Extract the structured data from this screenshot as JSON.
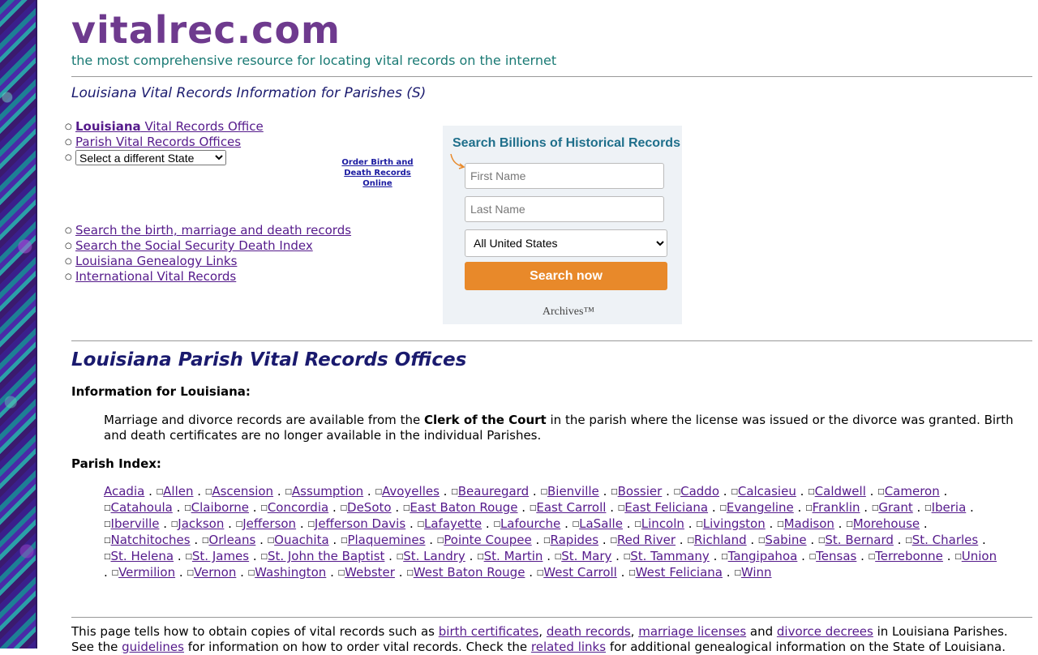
{
  "header": {
    "logo": "vitalrec.com",
    "tagline": "the most comprehensive resource for locating vital records on the internet",
    "subtitle": "Louisiana Vital Records Information for Parishes (S)"
  },
  "top_links": {
    "state_office_bold": "Louisiana",
    "state_office_rest": " Vital Records Office",
    "parish_offices": "Parish Vital Records Offices",
    "state_select_value": "Select a different State"
  },
  "order_link": {
    "line1": "Order Birth and",
    "line2": "Death Records Online"
  },
  "bottom_links": [
    "Search the birth, marriage and death records",
    "Search the Social Security Death Index",
    "Louisiana Genealogy Links",
    "International Vital Records"
  ],
  "search_widget": {
    "title": "Search Billions of Historical Records",
    "first_name_placeholder": "First Name",
    "last_name_placeholder": "Last Name",
    "location_value": "All United States",
    "button_label": "Search now",
    "brand": "Archives™",
    "button_color": "#e8892a",
    "title_color": "#1f6f8b"
  },
  "main": {
    "heading": "Louisiana Parish Vital Records Offices",
    "info_label": "Information for Louisiana:",
    "info_text_before": "Marriage and divorce records are available from the ",
    "info_text_bold": "Clerk of the Court",
    "info_text_after": " in the parish where the license was issued or the divorce was granted. Birth and death certificates are no longer available in the individual Parishes.",
    "index_label": "Parish Index:",
    "parishes": [
      "Acadia",
      "Allen",
      "Ascension",
      "Assumption",
      "Avoyelles",
      "Beauregard",
      "Bienville",
      "Bossier",
      "Caddo",
      "Calcasieu",
      "Caldwell",
      "Cameron",
      "Catahoula",
      "Claiborne",
      "Concordia",
      "DeSoto",
      "East Baton Rouge",
      "East Carroll",
      "East Feliciana",
      "Evangeline",
      "Franklin",
      "Grant",
      "Iberia",
      "Iberville",
      "Jackson",
      "Jefferson",
      "Jefferson Davis",
      "Lafayette",
      "Lafourche",
      "LaSalle",
      "Lincoln",
      "Livingston",
      "Madison",
      "Morehouse",
      "Natchitoches",
      "Orleans",
      "Ouachita",
      "Plaquemines",
      "Pointe Coupee",
      "Rapides",
      "Red River",
      "Richland",
      "Sabine",
      "St. Bernard",
      "St. Charles",
      "St. Helena",
      "St. James",
      "St. John the Baptist",
      "St. Landry",
      "St. Martin",
      "St. Mary",
      "St. Tammany",
      "Tangipahoa",
      "Tensas",
      "Terrebonne",
      "Union",
      "Vermilion",
      "Vernon",
      "Washington",
      "Webster",
      "West Baton Rouge",
      "West Carroll",
      "West Feliciana",
      "Winn"
    ]
  },
  "footer": {
    "t1": "This page tells how to obtain copies of vital records such as ",
    "birth": "birth certificates",
    "t2": ", ",
    "death": "death records",
    "t3": ", ",
    "marriage": "marriage licenses",
    "t4": " and ",
    "divorce": "divorce decrees",
    "t5": " in Louisiana Parishes. See the ",
    "guidelines": "guidelines",
    "t6": " for information on how to order vital records. Check the ",
    "related": "related links",
    "t7": " for additional genealogical information on the State of Louisiana."
  },
  "colors": {
    "logo": "#6e3a8e",
    "tagline": "#1a7a74",
    "heading": "#1a1a6e",
    "link": "#551a8b"
  }
}
